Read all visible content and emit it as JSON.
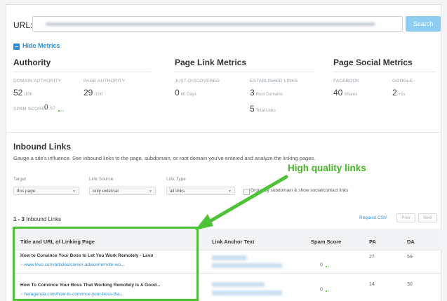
{
  "url_bar": {
    "label": "URL:",
    "search_label": "Search"
  },
  "hide_metrics_label": "Hide Metrics",
  "authority": {
    "title": "Authority",
    "domain_authority_label": "DOMAIN AUTHORITY",
    "domain_authority_value": "52",
    "domain_authority_max": "/100",
    "page_authority_label": "PAGE AUTHORITY",
    "page_authority_value": "29",
    "page_authority_max": "/100",
    "spam_score_label": "SPAM SCORE:",
    "spam_score_value": "0",
    "spam_score_max": "/17"
  },
  "page_link_metrics": {
    "title": "Page Link Metrics",
    "just_discovered_label": "JUST-DISCOVERED",
    "just_discovered_value": "0",
    "just_discovered_unit": "60 Days",
    "established_label": "ESTABLISHED LINKS",
    "root_domains_value": "3",
    "root_domains_unit": "Root Domains",
    "total_links_value": "5",
    "total_links_unit": "Total Links"
  },
  "page_social_metrics": {
    "title": "Page Social Metrics",
    "facebook_label": "FACEBOOK",
    "facebook_value": "40",
    "facebook_unit": "Shares",
    "google_label": "GOOGLE",
    "google_value": "2",
    "google_unit": "+1s"
  },
  "inbound": {
    "title": "Inbound Links",
    "description": "Gauge a site's influence. See inbound links to the page, subdomain, or root domain you've entered and analyze the linking pages.",
    "target_label": "Target",
    "target_value": "this page",
    "link_source_label": "Link Source",
    "link_source_value": "only external",
    "link_type_label": "Link Type",
    "link_type_value": "all links",
    "group_label": "Group by subdomain & show social/contact links",
    "count_text": "1 - 3",
    "count_suffix": "Inbound Links",
    "request_csv": "Request CSV",
    "prev_label": "Prev",
    "next_label": "Next"
  },
  "table": {
    "columns": [
      "Title and URL of Linking Page",
      "Link Anchor Text",
      "Spam Score",
      "PA",
      "DA"
    ],
    "rows": [
      {
        "title": "How to Convince Your Boss to Let You Work Remotely - Levo",
        "url": "www.levo.com/articles/career-advice/remote-wo...",
        "spam": "0",
        "pa": "27",
        "da": "59"
      },
      {
        "title": "How To Convince Your Boss That Working Remotely Is A Good...",
        "url": "heragenda.com/how-to-convince-your-boss-tha...",
        "spam": "0",
        "pa": "14",
        "da": "30"
      }
    ]
  },
  "annotation": {
    "text": "High quality links",
    "color": "#45b524"
  },
  "colors": {
    "accent": "#2b8fd6",
    "search_button": "#8dcdf2",
    "highlight": "#4dc435"
  }
}
